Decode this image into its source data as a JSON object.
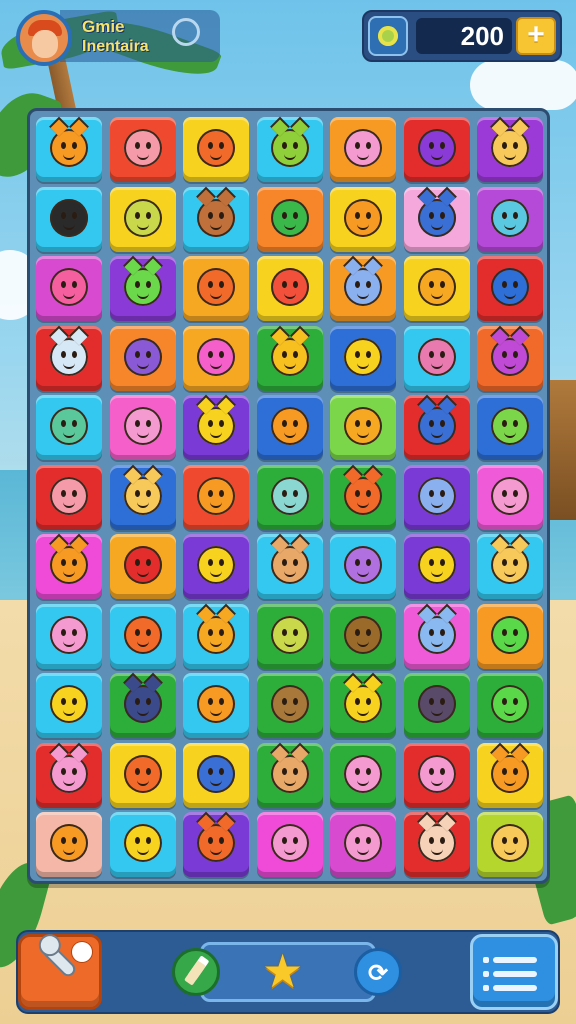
{
  "header": {
    "player_name": "Gmie",
    "player_subtitle": "Inentaira",
    "coins": "200",
    "add_coins_label": "+"
  },
  "icons": {
    "avatar": "player-avatar",
    "status": "ring-icon",
    "currency": "coin-icon",
    "tool": "wrench-icon",
    "hint": "pencil-icon",
    "favorite": "star-icon",
    "refresh": "refresh-icon",
    "menu": "list-menu-icon"
  },
  "board": {
    "columns": 7,
    "rows": 11,
    "tiles": [
      [
        "#34c8f0",
        "#ef4a2f",
        "#f7d21e",
        "#34c8f0",
        "#f79a23",
        "#e32d2d",
        "#9b3ad6"
      ],
      [
        "#34c8f0",
        "#f7d21e",
        "#34c8f0",
        "#f7862a",
        "#f7d21e",
        "#f5a8dc",
        "#b64ad8"
      ],
      [
        "#d84ad0",
        "#8a3ad6",
        "#f7a823",
        "#f7d21e",
        "#f79a23",
        "#f7d21e",
        "#e32d2d"
      ],
      [
        "#e32d2d",
        "#f7862a",
        "#f7a823",
        "#2dad3a",
        "#2d6fd6",
        "#34c8f0",
        "#f26a2a"
      ],
      [
        "#34c8f0",
        "#f55fc9",
        "#7a3ad6",
        "#2d6fd6",
        "#7cd64a",
        "#e32d2d",
        "#2d6fd6"
      ],
      [
        "#e32d2d",
        "#2d6fd6",
        "#ef4a2f",
        "#2dad3a",
        "#2dad3a",
        "#7a3ad6",
        "#ef5ad8"
      ],
      [
        "#ef4ad8",
        "#f7a823",
        "#7a3ad6",
        "#34c8f0",
        "#34c8f0",
        "#7a3ad6",
        "#34c8f0"
      ],
      [
        "#34c8f0",
        "#34c8f0",
        "#34c8f0",
        "#2dad3a",
        "#2dad3a",
        "#ef5ad8",
        "#f79a23"
      ],
      [
        "#34c8f0",
        "#2dad3a",
        "#34c8f0",
        "#2dad3a",
        "#2dad3a",
        "#2dad3a",
        "#2dad3a"
      ],
      [
        "#e32d2d",
        "#f7d21e",
        "#f7d21e",
        "#2dad3a",
        "#2dad3a",
        "#e32d2d",
        "#f7d21e"
      ],
      [
        "#f5b8a8",
        "#34c8f0",
        "#7a3ad6",
        "#ef4ad8",
        "#d84ad0",
        "#e32d2d",
        "#b5d62d"
      ]
    ],
    "critters": [
      [
        "#f79a23",
        "#f59aa8",
        "#f26a2a",
        "#8fcf3a",
        "#f59ad0",
        "#8a3ad6",
        "#f7c95a"
      ],
      [
        "#2a2a2a",
        "#c8d84a",
        "#c0703a",
        "#3ab84a",
        "#f79a23",
        "#3a6fd6",
        "#5ac8e0"
      ],
      [
        "#f55fa0",
        "#6ad84a",
        "#f26a2a",
        "#f2503a",
        "#8ab0f0",
        "#f7a823",
        "#2d6fd6"
      ],
      [
        "#d6e8f6",
        "#8a5ad6",
        "#f55fc9",
        "#f7c01e",
        "#f7d21e",
        "#e87ab0",
        "#c04ad6"
      ],
      [
        "#5ac89a",
        "#f59ad0",
        "#f7d21e",
        "#f79a23",
        "#f7a823",
        "#3a6fd6",
        "#7cd64a"
      ],
      [
        "#f59aa8",
        "#f7c95a",
        "#f79a23",
        "#8ad6d0",
        "#f26a2a",
        "#8ab0f0",
        "#f59ad0"
      ],
      [
        "#f79a23",
        "#e32d2d",
        "#f7d21e",
        "#e8a868",
        "#b070e0",
        "#f7d21e",
        "#f7c95a"
      ],
      [
        "#f59ad0",
        "#f26a2a",
        "#f7a823",
        "#c8d84a",
        "#9a6a2a",
        "#8ab8f0",
        "#5ad84a"
      ],
      [
        "#f7d21e",
        "#3a4a8a",
        "#f79a23",
        "#a8783a",
        "#f7d21e",
        "#5a4a6a",
        "#5ad84a"
      ],
      [
        "#f59ad0",
        "#f26a2a",
        "#3a6fd6",
        "#e8a868",
        "#f59ad0",
        "#f59ad0",
        "#f79a23"
      ],
      [
        "#f79a23",
        "#f7d21e",
        "#f26a2a",
        "#f59ad0",
        "#f59ad0",
        "#f5d2b8",
        "#f7c95a"
      ]
    ]
  }
}
